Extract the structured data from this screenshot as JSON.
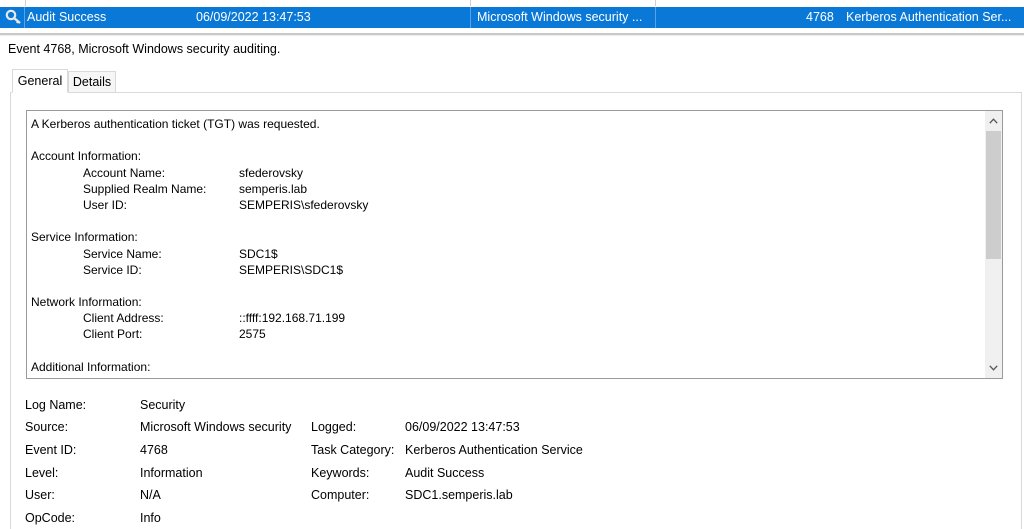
{
  "selected_event": {
    "level": "Audit Success",
    "date_time": "06/09/2022 13:47:53",
    "source": "Microsoft Windows security ...",
    "event_id": "4768",
    "task_category": "Kerberos Authentication Ser..."
  },
  "event_header": {
    "title": "Event 4768, Microsoft Windows security auditing."
  },
  "tabs": [
    {
      "label": "General"
    },
    {
      "label": "Details"
    }
  ],
  "description": {
    "lines": [
      "A Kerberos authentication ticket (TGT) was requested.",
      "",
      "Account Information:",
      "\tAccount Name:\t\tsfederovsky",
      "\tSupplied Realm Name:\tsemperis.lab",
      "\tUser ID:\t\t\tSEMPERIS\\sfederovsky",
      "",
      "Service Information:",
      "\tService Name:\t\tSDC1$",
      "\tService ID:\t\tSEMPERIS\\SDC1$",
      "",
      "Network Information:",
      "\tClient Address:\t\t::ffff:192.168.71.199",
      "\tClient Port:\t\t2575",
      "",
      "Additional Information:"
    ]
  },
  "properties": {
    "log_name": {
      "label": "Log Name:",
      "value": "Security"
    },
    "source": {
      "label": "Source:",
      "value": "Microsoft Windows security"
    },
    "logged": {
      "label": "Logged:",
      "value": "06/09/2022 13:47:53"
    },
    "event_id": {
      "label": "Event ID:",
      "value": "4768"
    },
    "task_category": {
      "label": "Task Category:",
      "value": "Kerberos Authentication Service"
    },
    "level": {
      "label": "Level:",
      "value": "Information"
    },
    "keywords": {
      "label": "Keywords:",
      "value": "Audit Success"
    },
    "user": {
      "label": "User:",
      "value": "N/A"
    },
    "computer": {
      "label": "Computer:",
      "value": "SDC1.semperis.lab"
    },
    "opcode": {
      "label": "OpCode:",
      "value": "Info"
    }
  },
  "icons": {
    "event_icon": "key-icon",
    "scroll_up": "chevron-up-icon",
    "scroll_down": "chevron-down-icon"
  },
  "colors": {
    "selection": "#0a78d7"
  }
}
